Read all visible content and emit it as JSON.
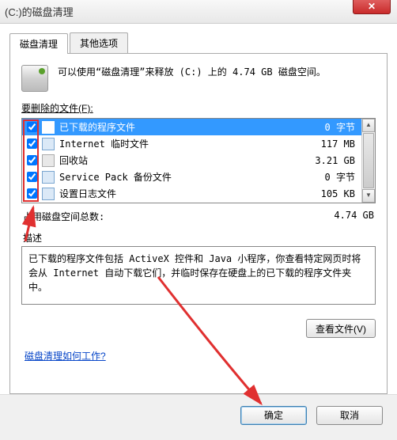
{
  "titlebar": {
    "title": "(C:)的磁盘清理"
  },
  "tabs": {
    "main": "磁盘清理",
    "other": "其他选项"
  },
  "intro": "可以使用“磁盘清理”来释放  (C:) 上的 4.74 GB 磁盘空间。",
  "section": {
    "files_label": "要删除的文件(F):"
  },
  "files": [
    {
      "name": "已下载的程序文件",
      "size": "0 字节",
      "checked": true,
      "selected": true
    },
    {
      "name": "Internet 临时文件",
      "size": "117 MB",
      "checked": true,
      "selected": false
    },
    {
      "name": "回收站",
      "size": "3.21 GB",
      "checked": true,
      "selected": false
    },
    {
      "name": "Service Pack 备份文件",
      "size": "0 字节",
      "checked": true,
      "selected": false
    },
    {
      "name": "设置日志文件",
      "size": "105 KB",
      "checked": true,
      "selected": false
    }
  ],
  "total": {
    "label": "占用磁盘空间总数:",
    "value": "4.74 GB"
  },
  "desc": {
    "label": "描述",
    "text": "已下载的程序文件包括 ActiveX 控件和 Java 小程序，你查看特定网页时将会从 Internet 自动下载它们，并临时保存在硬盘上的已下载的程序文件夹中。"
  },
  "buttons": {
    "view_files": "查看文件(V)",
    "ok": "确定",
    "cancel": "取消"
  },
  "link": {
    "how": "磁盘清理如何工作?"
  }
}
